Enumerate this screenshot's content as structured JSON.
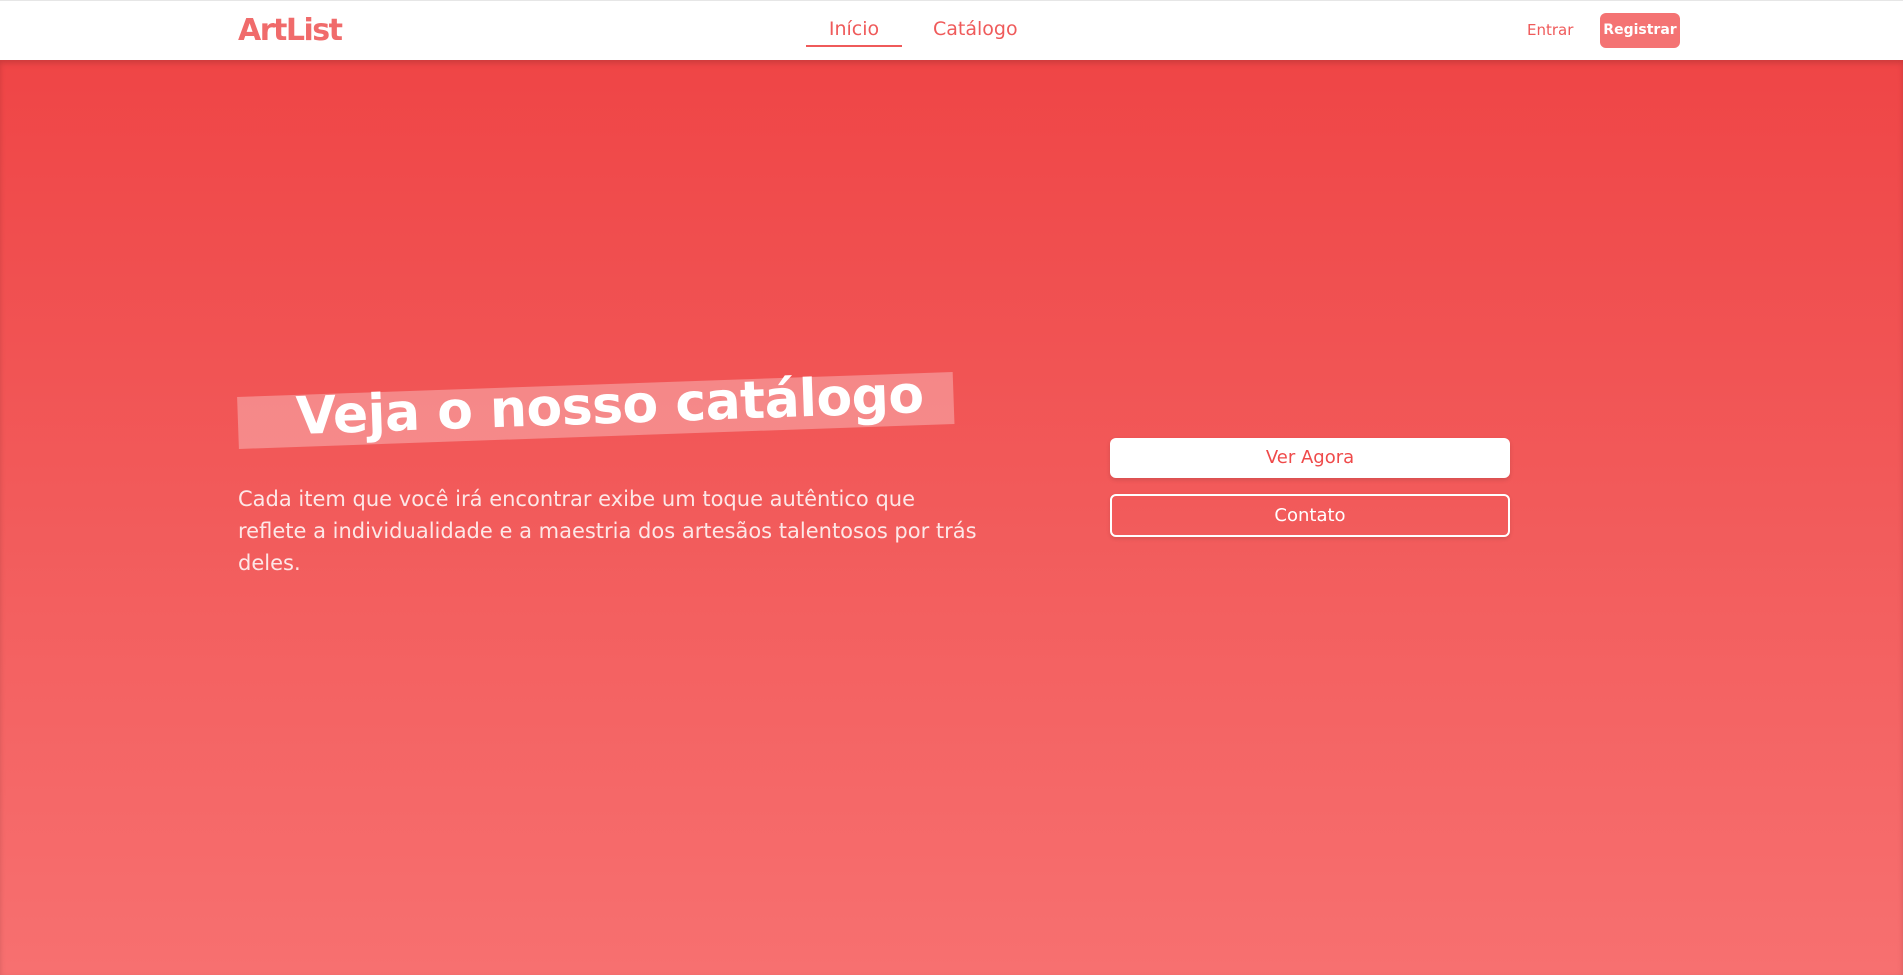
{
  "header": {
    "logo": "ArtList",
    "nav": [
      {
        "label": "Início",
        "active": true
      },
      {
        "label": "Catálogo",
        "active": false
      }
    ],
    "login_label": "Entrar",
    "register_label": "Registrar"
  },
  "hero": {
    "title": "Veja o nosso catálogo",
    "description": "Cada item que você irá encontrar exibe um toque autêntico que reflete a individualidade e a maestria dos artesãos talentosos por trás deles.",
    "primary_button": "Ver Agora",
    "secondary_button": "Contato"
  },
  "colors": {
    "brand": "#f06b6b",
    "hero_gradient_top": "#ef4546",
    "hero_gradient_bottom": "#f77070",
    "register_bg": "#f47373"
  }
}
